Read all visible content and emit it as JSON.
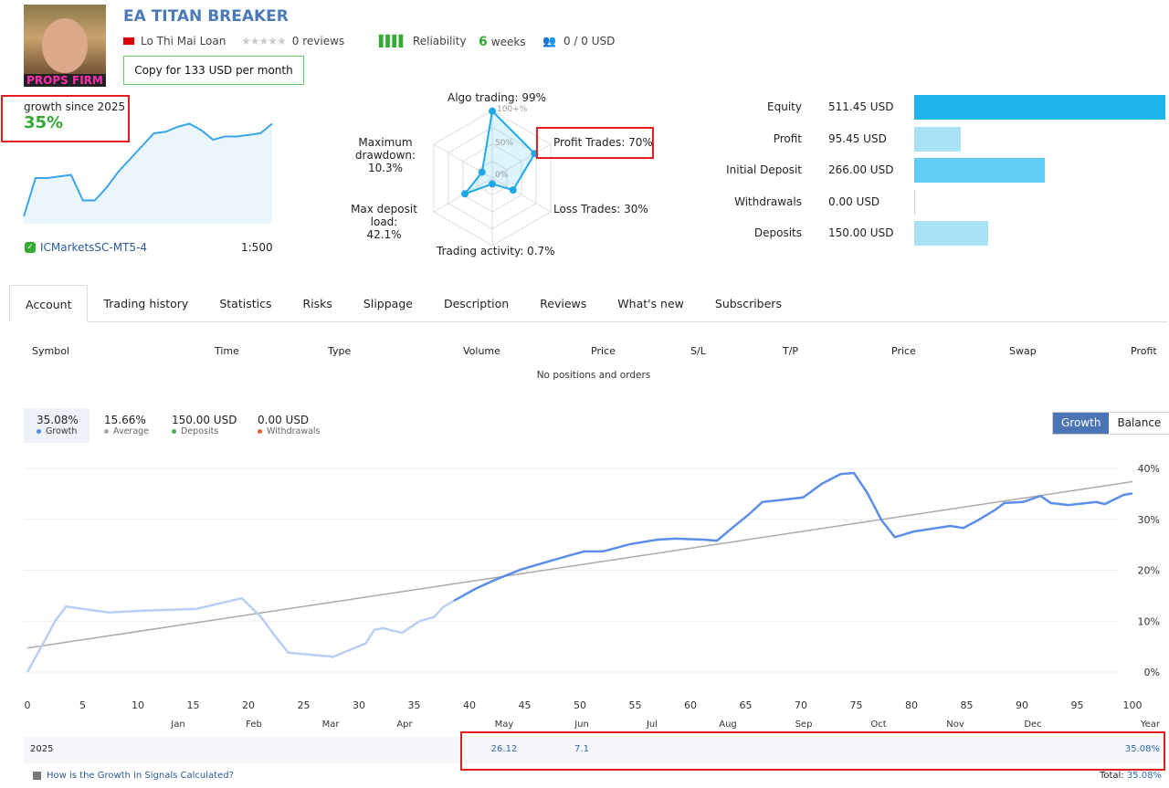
{
  "header": {
    "title": "EA TITAN BREAKER",
    "avatar_text": "PROPS FIRM",
    "author": "Lo Thi Mai Loan",
    "reviews": "0 reviews",
    "reliability": "Reliability",
    "weeks_num": "6",
    "weeks_label": "weeks",
    "subscribers": "0 / 0 USD",
    "copy_button": "Copy for 133 USD per month",
    "rating": 0
  },
  "summary": {
    "growth_label": "growth since 2025",
    "growth_value": "35%",
    "server": "ICMarketsSC-MT5-4",
    "leverage": "1:500",
    "sparkline": [
      0,
      12,
      12,
      12.5,
      13,
      5,
      5,
      9,
      14,
      18,
      22,
      26,
      26.5,
      28,
      29,
      27,
      24,
      25,
      25,
      25.5,
      26,
      29
    ]
  },
  "radar": {
    "labels": {
      "algo": "Algo trading: 99%",
      "profit": "Profit Trades: 70%",
      "loss": "Loss Trades: 30%",
      "activity": "Trading activity: 0.7%",
      "load_1": "Max deposit load:",
      "load_2": "42.1%",
      "dd_1": "Maximum",
      "dd_2": "drawdown: 10.3%"
    },
    "scale": {
      "s100": "100+%",
      "s50": "50%",
      "s0": "0%"
    },
    "values": [
      99,
      70,
      30,
      0.7,
      42.1,
      10.3
    ]
  },
  "balance": {
    "items": [
      {
        "label": "Equity",
        "value": "511.45 USD",
        "amount": 511.45,
        "color": "#1fb5ec"
      },
      {
        "label": "Profit",
        "value": "95.45 USD",
        "amount": 95.45,
        "color": "#a9e1f6"
      },
      {
        "label": "Initial Deposit",
        "value": "266.00 USD",
        "amount": 266,
        "color": "#5fcdf4"
      },
      {
        "label": "Withdrawals",
        "value": "0.00 USD",
        "amount": 0,
        "color": "#a9e1f6"
      },
      {
        "label": "Deposits",
        "value": "150.00 USD",
        "amount": 150,
        "color": "#a9e1f6"
      }
    ]
  },
  "tabs": [
    "Account",
    "Trading history",
    "Statistics",
    "Risks",
    "Slippage",
    "Description",
    "Reviews",
    "What's new",
    "Subscribers"
  ],
  "positions": {
    "headers": [
      "Symbol",
      "Time",
      "Type",
      "Volume",
      "Price",
      "S/L",
      "T/P",
      "Price",
      "Swap",
      "Profit"
    ],
    "empty": "No positions and orders"
  },
  "stats": [
    {
      "value": "35.08%",
      "label": "Growth",
      "color": "#4a90e2"
    },
    {
      "value": "15.66%",
      "label": "Average",
      "color": "#aaaaaa"
    },
    {
      "value": "150.00 USD",
      "label": "Deposits",
      "color": "#4caf50"
    },
    {
      "value": "0.00 USD",
      "label": "Withdrawals",
      "color": "#f06030"
    }
  ],
  "toggle": {
    "growth": "Growth",
    "balance": "Balance"
  },
  "chart_data": {
    "type": "line",
    "xlim": [
      0,
      100
    ],
    "ylim": [
      0,
      40
    ],
    "x_ticks": [
      "0",
      "5",
      "10",
      "15",
      "20",
      "25",
      "30",
      "35",
      "40",
      "45",
      "50",
      "55",
      "60",
      "65",
      "70",
      "75",
      "80",
      "85",
      "90",
      "95",
      "100"
    ],
    "y_ticks": [
      "0%",
      "10%",
      "20%",
      "30%",
      "40%"
    ],
    "grid": true,
    "series": [
      {
        "x": [
          0,
          1.2,
          2.5,
          3.5,
          5,
          7.4,
          9.9,
          12.4,
          15.3,
          17.4,
          19.4,
          21.1,
          22.3,
          23.6,
          25.6,
          27.7,
          28.9,
          30.6,
          31.4,
          32.2,
          33.9,
          35.5,
          36.8,
          37.6,
          38.6,
          40.5,
          42.1,
          44.6,
          47.1,
          49.2,
          50.4,
          52.1,
          54.5,
          57,
          58.7,
          61.2,
          62.4,
          63.6,
          65.3,
          66.5,
          68.6,
          70.2,
          71.9,
          73.6,
          74.8,
          76,
          77.3,
          78.5,
          80.2,
          83.5,
          84.7,
          86,
          87.6,
          88.4,
          90.1,
          91.7,
          92.6,
          94.2,
          95.9,
          96.7,
          97.5,
          99.2,
          100
        ],
        "y": [
          0,
          4.7,
          10,
          12.9,
          12.4,
          11.7,
          12,
          12.2,
          12.4,
          13.5,
          14.5,
          10.9,
          7.4,
          3.8,
          3.4,
          3,
          4.1,
          5.6,
          8.3,
          8.6,
          7.7,
          10,
          10.8,
          12.7,
          14,
          16.3,
          17.9,
          20.1,
          21.7,
          23,
          23.7,
          23.7,
          25.1,
          26,
          26.2,
          26,
          25.8,
          28,
          31,
          33.4,
          33.9,
          34.3,
          37,
          38.9,
          39.1,
          35.2,
          29.8,
          26.5,
          27.6,
          28.7,
          28.3,
          29.8,
          31.9,
          33.2,
          33.4,
          34.6,
          33.2,
          32.8,
          33.2,
          33.4,
          33,
          34.8,
          35.1
        ]
      },
      {
        "x": [
          0,
          100
        ],
        "y": [
          4.7,
          37.4
        ]
      }
    ]
  },
  "monthly": {
    "months": [
      "Jan",
      "Feb",
      "Mar",
      "Apr",
      "May",
      "Jun",
      "Jul",
      "Aug",
      "Sep",
      "Oct",
      "Nov",
      "Dec",
      "Year"
    ],
    "year": "2025",
    "values": [
      "",
      "",
      "",
      "",
      "26.12",
      "7.1",
      "",
      "",
      "",
      "",
      "",
      "",
      "35.08%"
    ],
    "help": "How is the Growth in Signals Calculated?",
    "total_label": "Total:",
    "total_value": "35.08%"
  }
}
